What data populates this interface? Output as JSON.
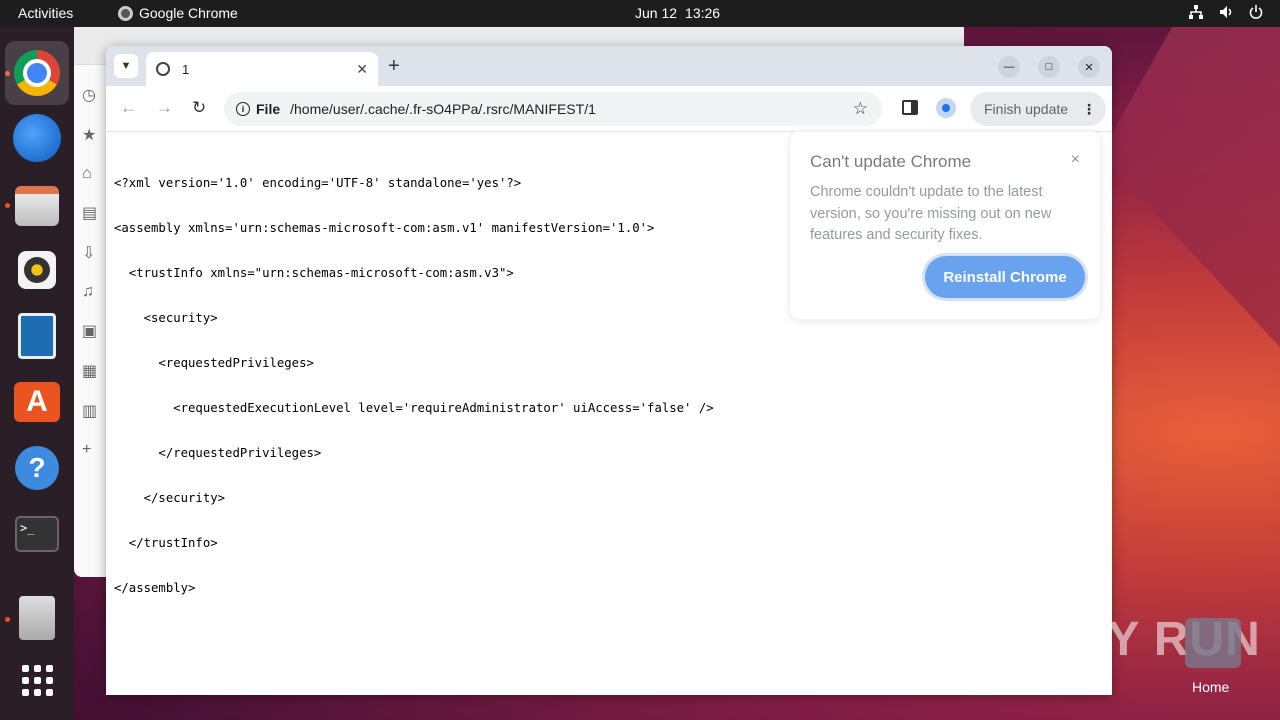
{
  "topbar": {
    "activities": "Activities",
    "app_name": "Google Chrome",
    "date": "Jun 12",
    "time": "13:26",
    "tray_icons": [
      "network-icon",
      "volume-icon",
      "power-icon"
    ]
  },
  "dock": {
    "items": [
      "chrome",
      "thunderbird",
      "files",
      "rhythmbox",
      "libreoffice-writer",
      "app-center",
      "help",
      "terminal",
      "archive-manager",
      "show-apps"
    ]
  },
  "browser": {
    "tab_title": "1",
    "new_tab_symbol": "+",
    "address_chip": "File",
    "url": "/home/user/.cache/.fr-sO4PPa/.rsrc/MANIFEST/1",
    "finish_update_label": "Finish update",
    "content_lines": [
      "<?xml version='1.0' encoding='UTF-8' standalone='yes'?>",
      "<assembly xmlns='urn:schemas-microsoft-com:asm.v1' manifestVersion='1.0'>",
      "  <trustInfo xmlns=\"urn:schemas-microsoft-com:asm.v3\">",
      "    <security>",
      "      <requestedPrivileges>",
      "        <requestedExecutionLevel level='requireAdministrator' uiAccess='false' />",
      "      </requestedPrivileges>",
      "    </security>",
      "  </trustInfo>",
      "</assembly>"
    ]
  },
  "popup": {
    "title": "Can't update Chrome",
    "body": "Chrome couldn't update to the latest version, so you're missing out on new features and security fixes.",
    "button": "Reinstall Chrome",
    "close": "×"
  },
  "desktop": {
    "watermark": "ANY RUN",
    "home_label": "Home"
  },
  "colors": {
    "accent": "#1a73e8",
    "ubuntu_orange": "#e95420",
    "topbar": "#1d1d1d"
  }
}
